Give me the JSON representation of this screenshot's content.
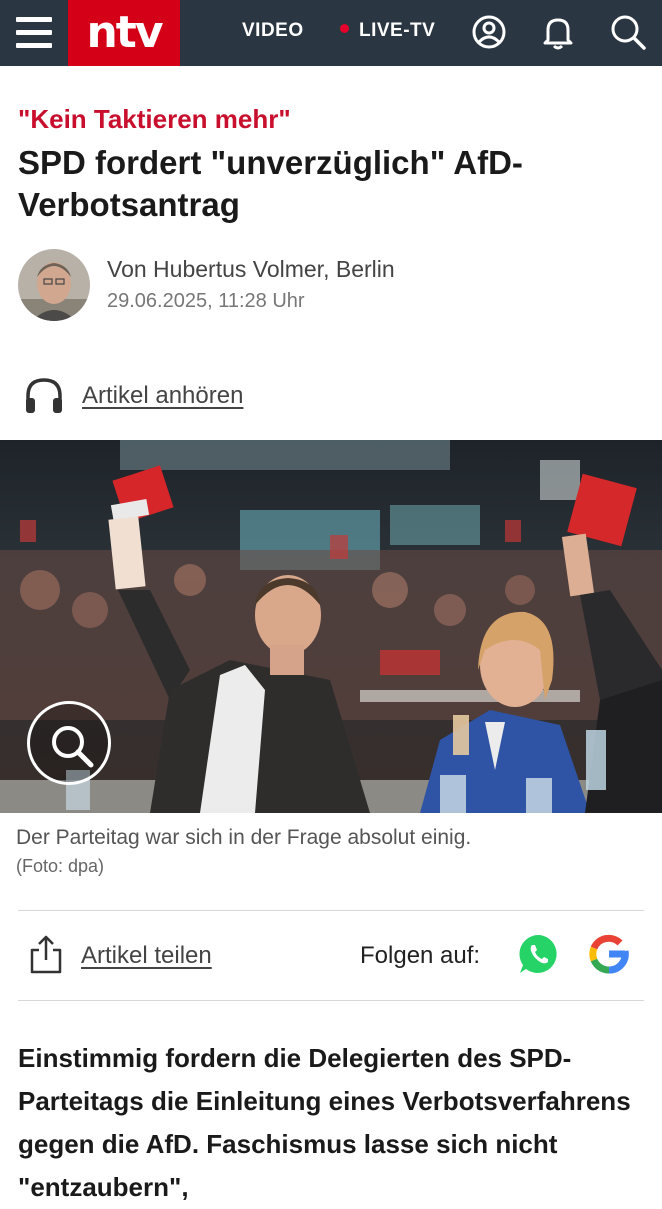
{
  "nav": {
    "logo_text": "ntv",
    "video_label": "VIDEO",
    "live_label": "LIVE-TV",
    "icons": [
      "menu-icon",
      "user-icon",
      "bell-icon",
      "search-icon"
    ]
  },
  "article": {
    "kicker": "\"Kein Taktieren mehr\"",
    "headline": "SPD fordert \"unverzüglich\" AfD-Verbotsantrag",
    "author": "Von Hubertus Volmer, Berlin",
    "date": "29.06.2025, 11:28 Uhr",
    "listen_label": "Artikel anhören",
    "image_caption": "Der Parteitag war sich in der Frage absolut einig.",
    "image_credit": "(Foto: dpa)",
    "share_label": "Artikel teilen",
    "follow_label": "Folgen auf:",
    "lead": "Einstimmig fordern die Delegierten des SPD-Parteitags die Einleitung eines Verbotsverfahrens gegen die AfD. Faschismus lasse sich nicht \"entzaubern\","
  },
  "colors": {
    "nav_bg": "#2a3641",
    "brand_red": "#d40018",
    "kicker_red": "#c8102e",
    "whatsapp_green": "#25d366"
  }
}
